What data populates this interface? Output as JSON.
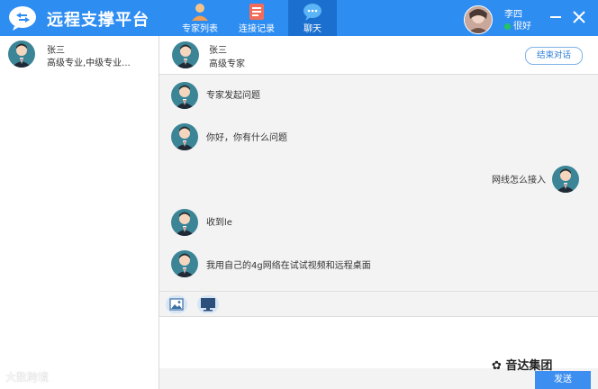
{
  "app": {
    "title": "远程支撑平台"
  },
  "tabs": [
    {
      "label": "专家列表",
      "icon": "expert-icon"
    },
    {
      "label": "连接记录",
      "icon": "record-icon"
    },
    {
      "label": "聊天",
      "icon": "chat-icon",
      "active": true
    }
  ],
  "user": {
    "name": "李四",
    "status": "很好",
    "status_color": "#22c55e"
  },
  "contacts": [
    {
      "name": "张三",
      "desc": "高级专业,中级专业..."
    }
  ],
  "chat": {
    "name": "张三",
    "role": "高级专家",
    "end_label": "结束对话",
    "messages": [
      {
        "text": "专家发起问题",
        "side": "left"
      },
      {
        "text": "你好，你有什么问题",
        "side": "left"
      },
      {
        "text": "网线怎么接入",
        "side": "right"
      },
      {
        "text": "收到le",
        "side": "left"
      },
      {
        "text": "我用自己的4g网络在试试视频和远程桌面",
        "side": "left"
      }
    ]
  },
  "composer": {
    "send_label": "发送"
  },
  "watermark": {
    "left": "大数跨境",
    "right": "音达集团"
  },
  "colors": {
    "accent": "#2e8df1",
    "active_tab": "#1a6fcf",
    "send": "#3c8ff0"
  }
}
